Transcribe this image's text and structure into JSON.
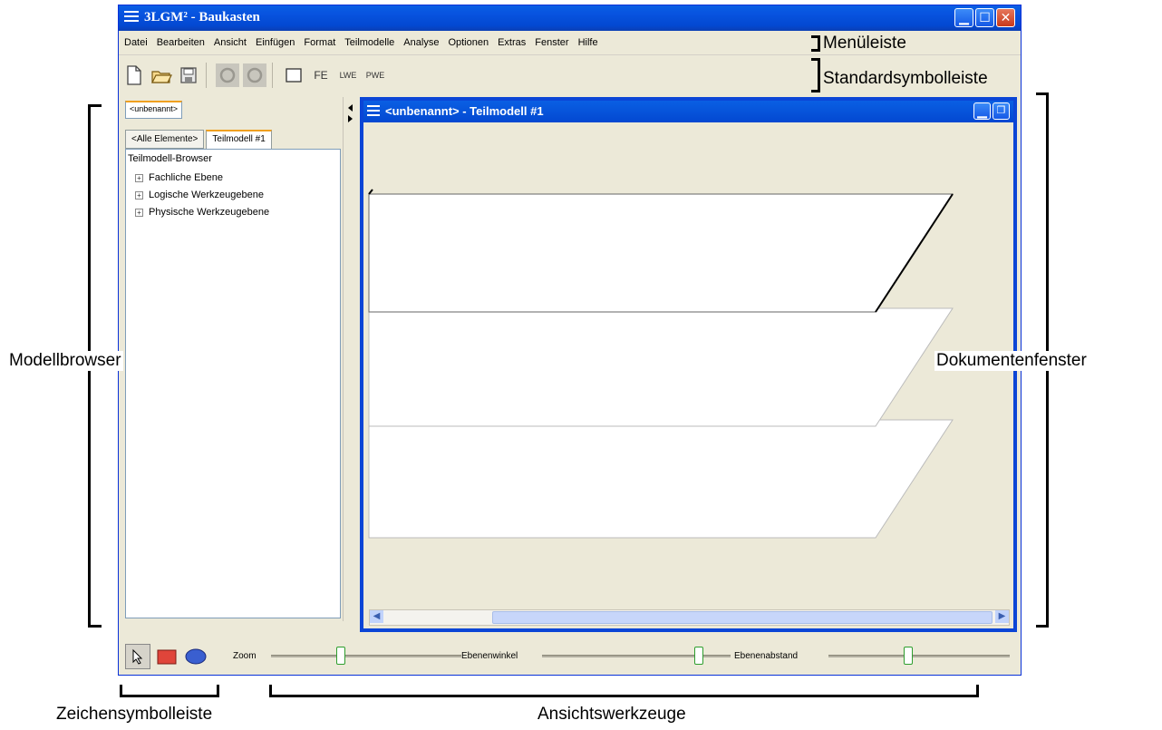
{
  "window": {
    "title": "3LGM² - Baukasten",
    "controls": [
      "minimize",
      "maximize",
      "close"
    ]
  },
  "menubar": {
    "items": [
      "Datei",
      "Bearbeiten",
      "Ansicht",
      "Einfügen",
      "Format",
      "Teilmodelle",
      "Analyse",
      "Optionen",
      "Extras",
      "Fenster",
      "Hilfe"
    ]
  },
  "toolbar": {
    "buttons": [
      {
        "icon": "new-document-icon"
      },
      {
        "icon": "open-folder-icon"
      },
      {
        "icon": "save-icon"
      },
      {
        "icon": "undo-icon"
      },
      {
        "icon": "redo-icon"
      },
      {
        "icon": "rectangle-icon"
      },
      {
        "label": "FE"
      },
      {
        "label": "LWE"
      },
      {
        "label": "PWE"
      }
    ]
  },
  "browser": {
    "top_tab": "<unbenannt>",
    "tabs": [
      "<Alle Elemente>",
      "Teilmodell #1"
    ],
    "active_tab": "Teilmodell #1",
    "tree_title": "Teilmodell-Browser",
    "tree_items": [
      "Fachliche Ebene",
      "Logische Werkzeugebene",
      "Physische Werkzeugebene"
    ]
  },
  "document": {
    "title": "<unbenannt> - Teilmodell #1",
    "layer_count": 3
  },
  "drawing_tools": [
    "pointer-icon",
    "rectangle-tool-icon",
    "ellipse-tool-icon"
  ],
  "view_tools": {
    "zoom_label": "Zoom",
    "angle_label": "Ebenenwinkel",
    "distance_label": "Ebenenabstand"
  },
  "annotations": {
    "menubar": "Menüleiste",
    "toolbar": "Standardsymbolleiste",
    "browser": "Modellbrowser",
    "document": "Dokumentenfenster",
    "drawing": "Zeichensymbolleiste",
    "view": "Ansichtswerkzeuge"
  },
  "colors": {
    "titlebar": "#0854e0",
    "close": "#c8391a",
    "accent_tab": "#f0a020",
    "draw_rect": "#e0453a",
    "draw_ellipse": "#3a5fd0",
    "slider_thumb": "#2e9e2e"
  }
}
